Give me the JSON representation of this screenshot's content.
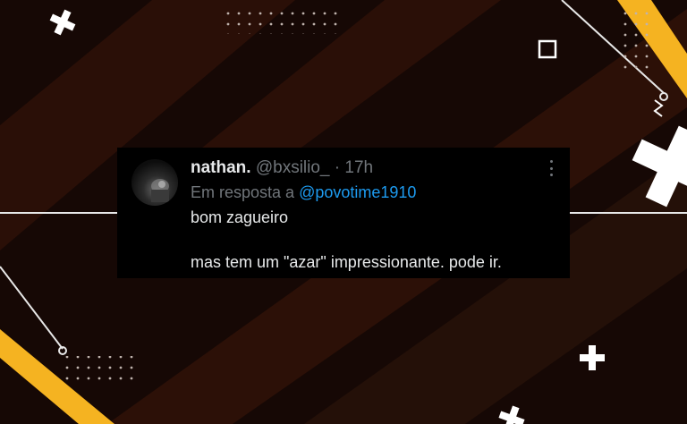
{
  "tweet": {
    "display_name": "nathan.",
    "handle": "@bxsilio_",
    "separator": "·",
    "time": "17h",
    "reply_prefix": "Em resposta a",
    "reply_to": "@povotime1910",
    "lines": [
      "bom zagueiro",
      "mas tem um \"azar\" impressionante. pode ir."
    ],
    "more_icon": "more-vertical-icon",
    "avatar_icon": "avatar"
  },
  "colors": {
    "background": "#160805",
    "accent_yellow": "#f5b321",
    "card": "#000000",
    "text_primary": "#e7e9ea",
    "text_secondary": "#71767b",
    "link": "#1d9bf0"
  }
}
